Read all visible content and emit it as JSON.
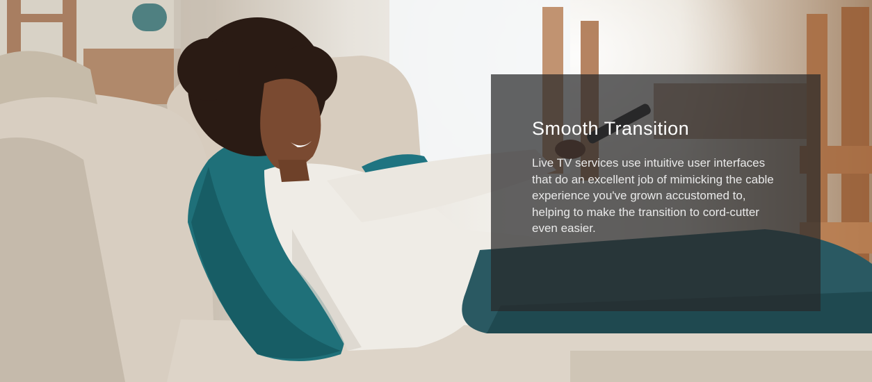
{
  "hero": {
    "photo_subject": "smiling-woman-on-couch-with-remote",
    "overlay": {
      "title": "Smooth Transition",
      "body": "Live TV services use intuitive user interfaces that do an excellent job of mimicking the cable experience you've grown accustomed to, helping to make the transition to cord-cutter even easier.",
      "background_color": "#28282a",
      "text_color": "#ffffff"
    },
    "colors": {
      "pillow": "#1c6f78",
      "couch": "#d9cfc2",
      "jeans": "#2c5b64",
      "sweater": "#efece6"
    }
  }
}
